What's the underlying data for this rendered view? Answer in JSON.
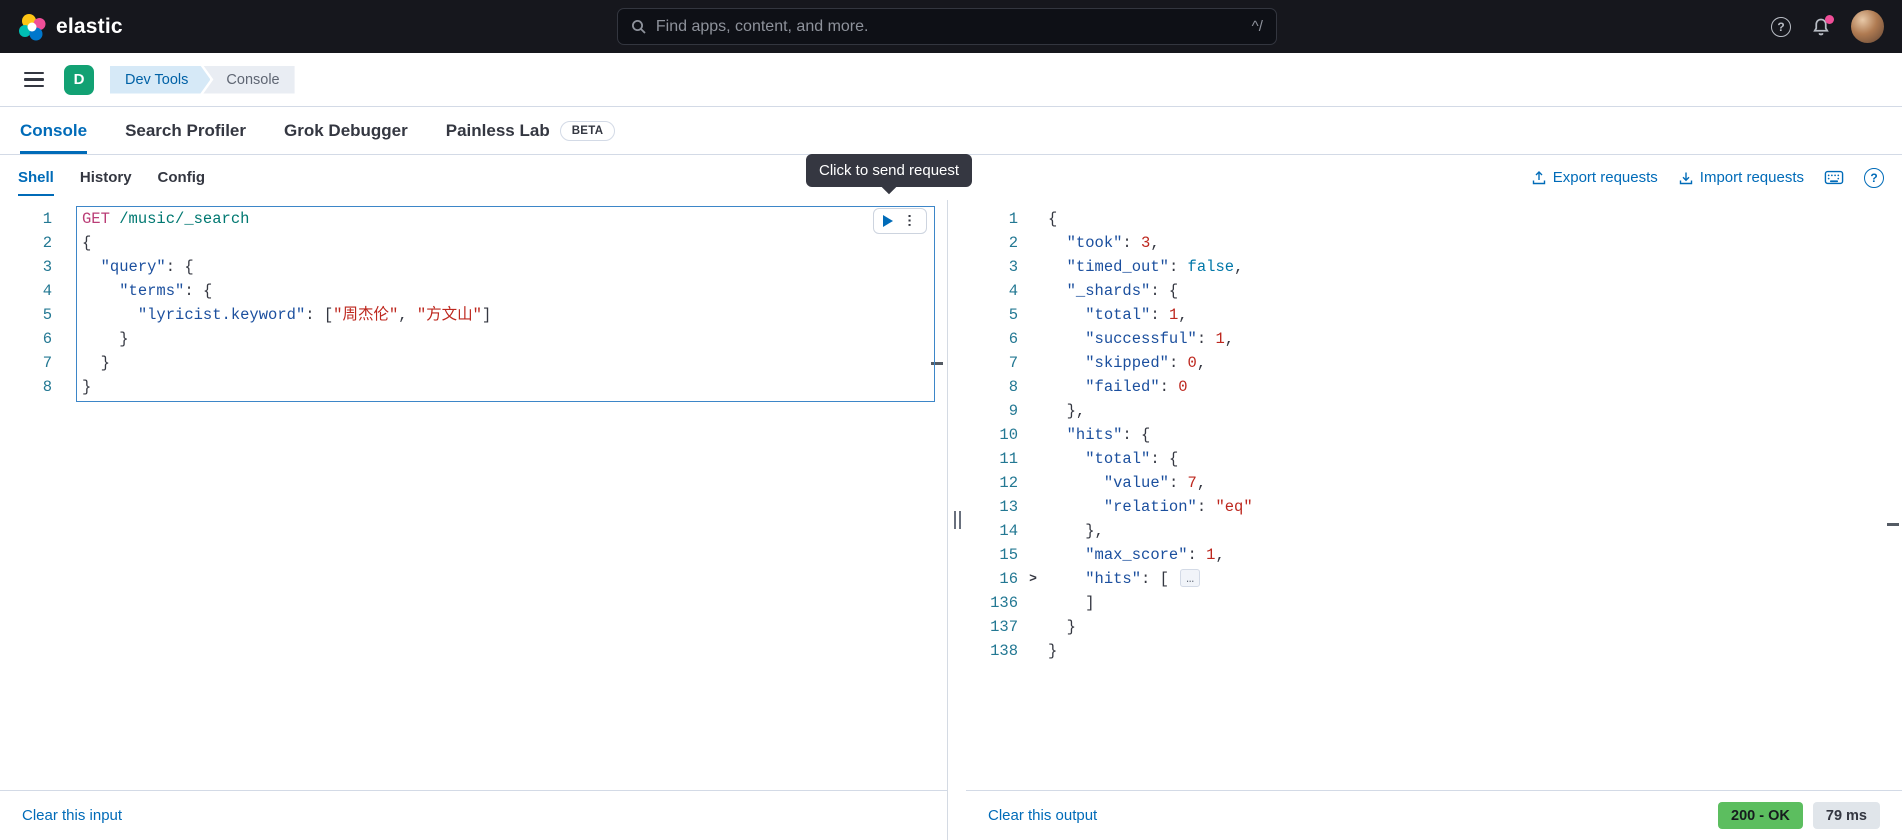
{
  "topbar": {
    "brand": "elastic",
    "search": {
      "placeholder": "Find apps, content, and more.",
      "shortcut_hint": "^/"
    }
  },
  "breadcrumb_bar": {
    "space_initial": "D",
    "breadcrumbs": [
      "Dev Tools",
      "Console"
    ]
  },
  "app_tabs": [
    {
      "label": "Console",
      "active": true
    },
    {
      "label": "Search Profiler",
      "active": false
    },
    {
      "label": "Grok Debugger",
      "active": false
    },
    {
      "label": "Painless Lab",
      "active": false,
      "badge": "BETA"
    }
  ],
  "icons": {
    "question": "?",
    "ellipsis": "…",
    "fold_chevron": ">"
  },
  "colors": {
    "accent_blue": "#006bb8",
    "space_badge_green": "#12a173",
    "status_ok_green": "#5cbe5f",
    "badge_gray": "#e0e5ea",
    "tooltip_bg": "#353741",
    "selection_border": "#3d86c8",
    "notification_pink": "#f04e98"
  },
  "console": {
    "subtabs": [
      {
        "label": "Shell",
        "active": true
      },
      {
        "label": "History",
        "active": false
      },
      {
        "label": "Config",
        "active": false
      }
    ],
    "header_actions": {
      "export": "Export requests",
      "import": "Import requests"
    },
    "tooltip": "Click to send request",
    "editor": {
      "clear_label": "Clear this input",
      "request": {
        "method": "GET",
        "path": "/music/_search"
      },
      "lines": [
        {
          "n": 1,
          "tokens": [
            [
              "m",
              "GET"
            ],
            [
              "p",
              " "
            ],
            [
              "u",
              "/music/_search"
            ]
          ]
        },
        {
          "n": 2,
          "tokens": [
            [
              "p",
              "{"
            ]
          ]
        },
        {
          "n": 3,
          "tokens": [
            [
              "p",
              "  "
            ],
            [
              "k",
              "\"query\""
            ],
            [
              "p",
              ": {"
            ]
          ]
        },
        {
          "n": 4,
          "tokens": [
            [
              "p",
              "    "
            ],
            [
              "k",
              "\"terms\""
            ],
            [
              "p",
              ": {"
            ]
          ]
        },
        {
          "n": 5,
          "tokens": [
            [
              "p",
              "      "
            ],
            [
              "k",
              "\"lyricist.keyword\""
            ],
            [
              "p",
              ": ["
            ],
            [
              "s",
              "\"周杰伦\""
            ],
            [
              "p",
              ", "
            ],
            [
              "s",
              "\"方文山\""
            ],
            [
              "p",
              "]"
            ]
          ]
        },
        {
          "n": 6,
          "tokens": [
            [
              "p",
              "    }"
            ]
          ]
        },
        {
          "n": 7,
          "tokens": [
            [
              "p",
              "  }"
            ]
          ]
        },
        {
          "n": 8,
          "tokens": [
            [
              "p",
              "}"
            ]
          ]
        }
      ]
    },
    "output": {
      "clear_label": "Clear this output",
      "status_badge": "200 - OK",
      "time_badge": "79 ms",
      "lines": [
        {
          "n": 1,
          "tokens": [
            [
              "p",
              "{"
            ]
          ]
        },
        {
          "n": 2,
          "tokens": [
            [
              "p",
              "  "
            ],
            [
              "k",
              "\"took\""
            ],
            [
              "p",
              ": "
            ],
            [
              "n",
              "3"
            ],
            [
              "p",
              ","
            ]
          ]
        },
        {
          "n": 3,
          "tokens": [
            [
              "p",
              "  "
            ],
            [
              "k",
              "\"timed_out\""
            ],
            [
              "p",
              ": "
            ],
            [
              "b",
              "false"
            ],
            [
              "p",
              ","
            ]
          ]
        },
        {
          "n": 4,
          "tokens": [
            [
              "p",
              "  "
            ],
            [
              "k",
              "\"_shards\""
            ],
            [
              "p",
              ": {"
            ]
          ]
        },
        {
          "n": 5,
          "tokens": [
            [
              "p",
              "    "
            ],
            [
              "k",
              "\"total\""
            ],
            [
              "p",
              ": "
            ],
            [
              "n",
              "1"
            ],
            [
              "p",
              ","
            ]
          ]
        },
        {
          "n": 6,
          "tokens": [
            [
              "p",
              "    "
            ],
            [
              "k",
              "\"successful\""
            ],
            [
              "p",
              ": "
            ],
            [
              "n",
              "1"
            ],
            [
              "p",
              ","
            ]
          ]
        },
        {
          "n": 7,
          "tokens": [
            [
              "p",
              "    "
            ],
            [
              "k",
              "\"skipped\""
            ],
            [
              "p",
              ": "
            ],
            [
              "n",
              "0"
            ],
            [
              "p",
              ","
            ]
          ]
        },
        {
          "n": 8,
          "tokens": [
            [
              "p",
              "    "
            ],
            [
              "k",
              "\"failed\""
            ],
            [
              "p",
              ": "
            ],
            [
              "n",
              "0"
            ]
          ]
        },
        {
          "n": 9,
          "tokens": [
            [
              "p",
              "  },"
            ]
          ]
        },
        {
          "n": 10,
          "tokens": [
            [
              "p",
              "  "
            ],
            [
              "k",
              "\"hits\""
            ],
            [
              "p",
              ": {"
            ]
          ]
        },
        {
          "n": 11,
          "tokens": [
            [
              "p",
              "    "
            ],
            [
              "k",
              "\"total\""
            ],
            [
              "p",
              ": {"
            ]
          ]
        },
        {
          "n": 12,
          "tokens": [
            [
              "p",
              "      "
            ],
            [
              "k",
              "\"value\""
            ],
            [
              "p",
              ": "
            ],
            [
              "n",
              "7"
            ],
            [
              "p",
              ","
            ]
          ]
        },
        {
          "n": 13,
          "tokens": [
            [
              "p",
              "      "
            ],
            [
              "k",
              "\"relation\""
            ],
            [
              "p",
              ": "
            ],
            [
              "s",
              "\"eq\""
            ]
          ]
        },
        {
          "n": 14,
          "tokens": [
            [
              "p",
              "    },"
            ]
          ]
        },
        {
          "n": 15,
          "tokens": [
            [
              "p",
              "    "
            ],
            [
              "k",
              "\"max_score\""
            ],
            [
              "p",
              ": "
            ],
            [
              "n",
              "1"
            ],
            [
              "p",
              ","
            ]
          ]
        },
        {
          "n": 16,
          "fold": true,
          "tokens": [
            [
              "p",
              "    "
            ],
            [
              "k",
              "\"hits\""
            ],
            [
              "p",
              ": [ "
            ],
            [
              "e",
              "…"
            ]
          ]
        },
        {
          "n": 136,
          "tokens": [
            [
              "p",
              "    ]"
            ]
          ]
        },
        {
          "n": 137,
          "tokens": [
            [
              "p",
              "  }"
            ]
          ]
        },
        {
          "n": 138,
          "tokens": [
            [
              "p",
              "}"
            ]
          ]
        }
      ]
    }
  }
}
